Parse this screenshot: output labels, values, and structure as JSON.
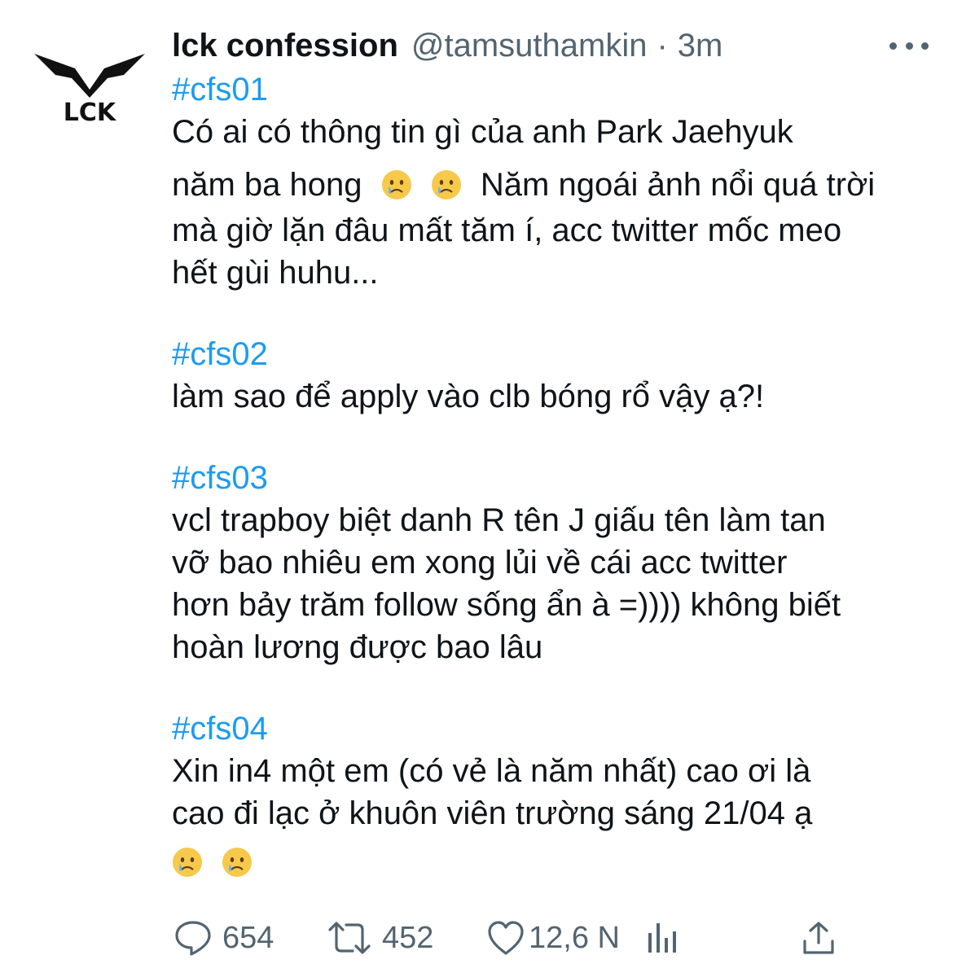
{
  "tweet": {
    "display_name": "lck confession",
    "handle": "@tamsuthamkin",
    "separator": "·",
    "time": "3m",
    "avatar_text": "LCK",
    "posts": [
      {
        "hashtag": "#cfs01",
        "lines": [
          "Có ai có thông tin gì của anh Park Jaehyuk"
        ],
        "line_with_emoji_prefix": "năm ba hong",
        "line_with_emoji_suffix": " Năm ngoái ảnh nổi quá trời",
        "lines_after": [
          "mà giờ lặn đâu mất tăm í, acc twitter mốc meo",
          "hết gùi huhu..."
        ]
      },
      {
        "hashtag": "#cfs02",
        "lines": [
          "làm sao để apply vào clb bóng rổ vậy ạ?!"
        ]
      },
      {
        "hashtag": "#cfs03",
        "lines": [
          "vcl trapboy biệt danh R tên J giấu tên làm tan",
          "vỡ bao nhiêu em xong lủi về cái acc twitter",
          "hơn bảy trăm follow sống ẩn à =)))) không biết",
          "hoàn lương được bao lâu"
        ]
      },
      {
        "hashtag": "#cfs04",
        "lines": [
          "Xin in4 một em (có vẻ là năm nhất) cao ơi là",
          "cao đi lạc ở khuôn viên trường sáng 21/04 ạ"
        ]
      }
    ],
    "emoji_name": "crying-face-icon",
    "actions": {
      "reply_count": "654",
      "retweet_count": "452",
      "like_count": "12,6 N"
    },
    "colors": {
      "link": "#1d9bf0",
      "muted": "#536471",
      "text": "#0f1419"
    }
  }
}
